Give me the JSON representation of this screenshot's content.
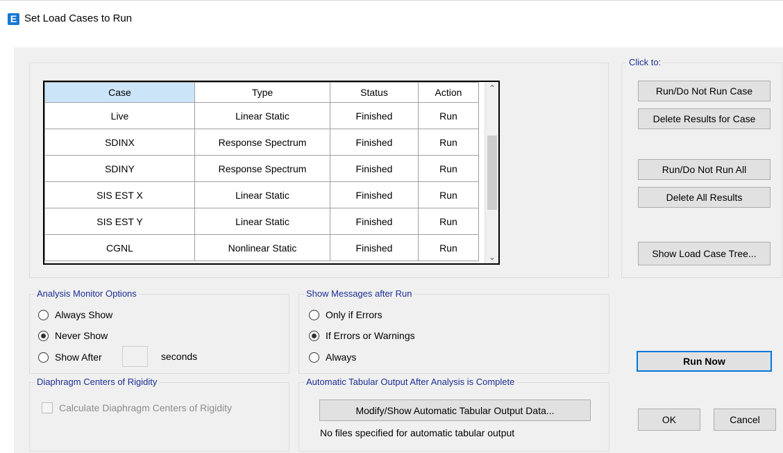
{
  "window": {
    "title": "Set Load Cases to Run",
    "icon": "E"
  },
  "table": {
    "columns": [
      "Case",
      "Type",
      "Status",
      "Action"
    ],
    "rows": [
      [
        "Live",
        "Linear Static",
        "Finished",
        "Run"
      ],
      [
        "SDINX",
        "Response Spectrum",
        "Finished",
        "Run"
      ],
      [
        "SDINY",
        "Response Spectrum",
        "Finished",
        "Run"
      ],
      [
        "SIS EST X",
        "Linear Static",
        "Finished",
        "Run"
      ],
      [
        "SIS EST Y",
        "Linear Static",
        "Finished",
        "Run"
      ],
      [
        "CGNL",
        "Nonlinear Static",
        "Finished",
        "Run"
      ]
    ]
  },
  "click_to": {
    "legend": "Click to:",
    "run_do_not_run_case": "Run/Do Not Run Case",
    "delete_results_for_case": "Delete Results for Case",
    "run_do_not_run_all": "Run/Do Not Run All",
    "delete_all_results": "Delete All Results",
    "show_load_case_tree": "Show Load Case Tree..."
  },
  "analysis_monitor": {
    "legend": "Analysis Monitor Options",
    "always_show": "Always Show",
    "never_show": "Never Show",
    "show_after": "Show After",
    "seconds": "seconds",
    "selected": "never_show"
  },
  "show_messages": {
    "legend": "Show Messages after Run",
    "only_if_errors": "Only if Errors",
    "if_errors_or_warnings": "If Errors or Warnings",
    "always": "Always",
    "selected": "if_errors_or_warnings"
  },
  "diaphragm": {
    "legend": "Diaphragm Centers of Rigidity",
    "calculate": "Calculate Diaphragm Centers of Rigidity"
  },
  "tabular_output": {
    "legend": "Automatic Tabular Output After Analysis is Complete",
    "modify_button": "Modify/Show Automatic Tabular Output Data...",
    "status": "No files specified for automatic tabular output"
  },
  "actions": {
    "run_now": "Run Now",
    "ok": "OK",
    "cancel": "Cancel"
  }
}
